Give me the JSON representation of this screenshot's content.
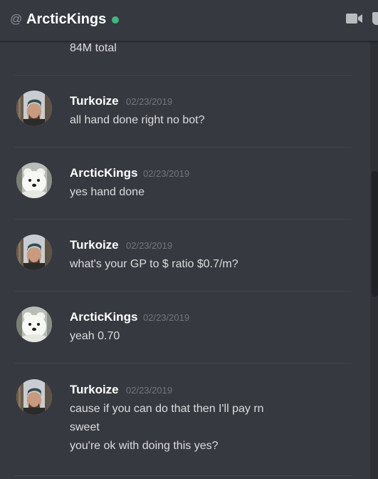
{
  "header": {
    "at_symbol": "@",
    "title": "ArcticKings",
    "status": "online",
    "status_color": "#43b581",
    "icons": [
      "video-call-icon",
      "pin-icon"
    ]
  },
  "top_partial": {
    "text": "84M total"
  },
  "messages": [
    {
      "author": "Turkoize",
      "timestamp": "02/23/2019",
      "avatar": "man-avatar",
      "lines": [
        "all hand done right no bot?"
      ]
    },
    {
      "author": "ArcticKings",
      "timestamp": "02/23/2019",
      "avatar": "polar-bear-avatar",
      "lines": [
        "yes hand done"
      ]
    },
    {
      "author": "Turkoize",
      "timestamp": "02/23/2019",
      "avatar": "man-avatar",
      "lines": [
        "what's your GP to $ ratio $0.7/m?"
      ]
    },
    {
      "author": "ArcticKings",
      "timestamp": "02/23/2019",
      "avatar": "polar-bear-avatar",
      "lines": [
        "yeah 0.70"
      ]
    },
    {
      "author": "Turkoize",
      "timestamp": "02/23/2019",
      "avatar": "man-avatar",
      "lines": [
        "cause if you can do that then I'll pay rn",
        "sweet",
        "you're ok with doing this yes?"
      ]
    }
  ]
}
